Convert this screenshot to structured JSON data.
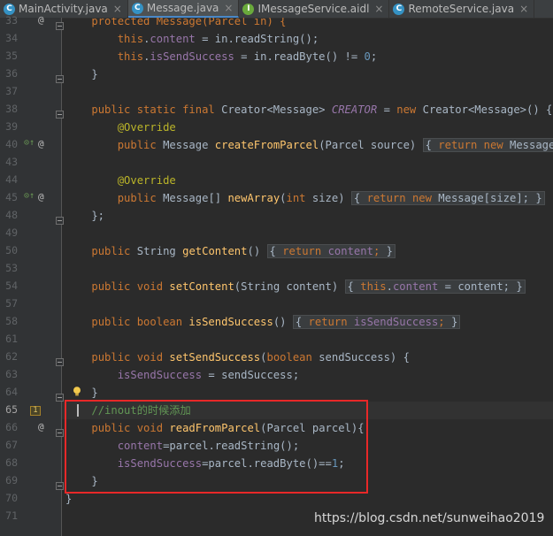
{
  "tabs": [
    {
      "label": "MainActivity.java",
      "icon": "class-icon",
      "active": false
    },
    {
      "label": "Message.java",
      "icon": "class-icon",
      "active": true
    },
    {
      "label": "IMessageService.aidl",
      "icon": "interface-icon",
      "active": false
    },
    {
      "label": "RemoteService.java",
      "icon": "class-icon",
      "active": false
    }
  ],
  "line_numbers": [
    "33",
    "34",
    "35",
    "36",
    "37",
    "38",
    "39",
    "40",
    "43",
    "44",
    "45",
    "48",
    "49",
    "50",
    "53",
    "54",
    "57",
    "58",
    "61",
    "62",
    "63",
    "64",
    "65",
    "66",
    "67",
    "68",
    "69",
    "70",
    "71"
  ],
  "current_line": "65",
  "bookmark": "1",
  "code": {
    "l33": [
      "    protected Message(Parcel in) {"
    ],
    "l34": [
      "        ",
      "this",
      ".",
      "content",
      " = in.readString();"
    ],
    "l35": [
      "        ",
      "this",
      ".",
      "isSendSuccess",
      " = in.readByte() != ",
      "0",
      ";"
    ],
    "l36": [
      "    }"
    ],
    "l37": [
      ""
    ],
    "l38": [
      "    ",
      "public static final ",
      "Creator<Message> ",
      "CREATOR",
      " = ",
      "new ",
      "Creator<Message>() {"
    ],
    "l39": [
      "        ",
      "@Override"
    ],
    "l40": [
      "        ",
      "public ",
      "Message ",
      "createFromParcel",
      "(Parcel source) ",
      "{ ",
      "return new ",
      "Message(sou"
    ],
    "l43": [
      ""
    ],
    "l44": [
      "        ",
      "@Override"
    ],
    "l45": [
      "        ",
      "public ",
      "Message[] ",
      "newArray",
      "(",
      "int ",
      "size) ",
      "{ ",
      "return new ",
      "Message[size]; ",
      "}"
    ],
    "l48": [
      "    };"
    ],
    "l49": [
      ""
    ],
    "l50": [
      "    ",
      "public ",
      "String ",
      "getContent",
      "() ",
      "{ ",
      "return ",
      "content",
      "; ",
      "}"
    ],
    "l53": [
      ""
    ],
    "l54": [
      "    ",
      "public void ",
      "setContent",
      "(String content) ",
      "{ ",
      "this",
      ".",
      "content",
      " = content; ",
      "}"
    ],
    "l57": [
      ""
    ],
    "l58": [
      "    ",
      "public boolean ",
      "isSendSuccess",
      "() ",
      "{ ",
      "return ",
      "isSendSuccess",
      "; ",
      "}"
    ],
    "l61": [
      ""
    ],
    "l62": [
      "    ",
      "public void ",
      "setSendSuccess",
      "(",
      "boolean ",
      "sendSuccess) {"
    ],
    "l63": [
      "        ",
      "isSendSuccess",
      " = sendSuccess;"
    ],
    "l64": [
      "    }"
    ],
    "l65": [
      "    ",
      "//inout的时候添加"
    ],
    "l66": [
      "    ",
      "public void ",
      "readFromParcel",
      "(Parcel parcel){"
    ],
    "l67": [
      "        ",
      "content",
      "=parcel.readString();"
    ],
    "l68": [
      "        ",
      "isSendSuccess",
      "=parcel.readByte()==",
      "1",
      ";"
    ],
    "l69": [
      "    }"
    ],
    "l70": [
      "}"
    ],
    "l71": [
      ""
    ]
  },
  "watermark": "https://blog.csdn.net/sunweihao2019",
  "colors": {
    "keyword": "#cc7832",
    "field": "#9876aa",
    "method": "#ffc66d",
    "annotation": "#bbb529",
    "number": "#6897bb",
    "comment": "#629755",
    "highlight_box": "#e82828"
  }
}
